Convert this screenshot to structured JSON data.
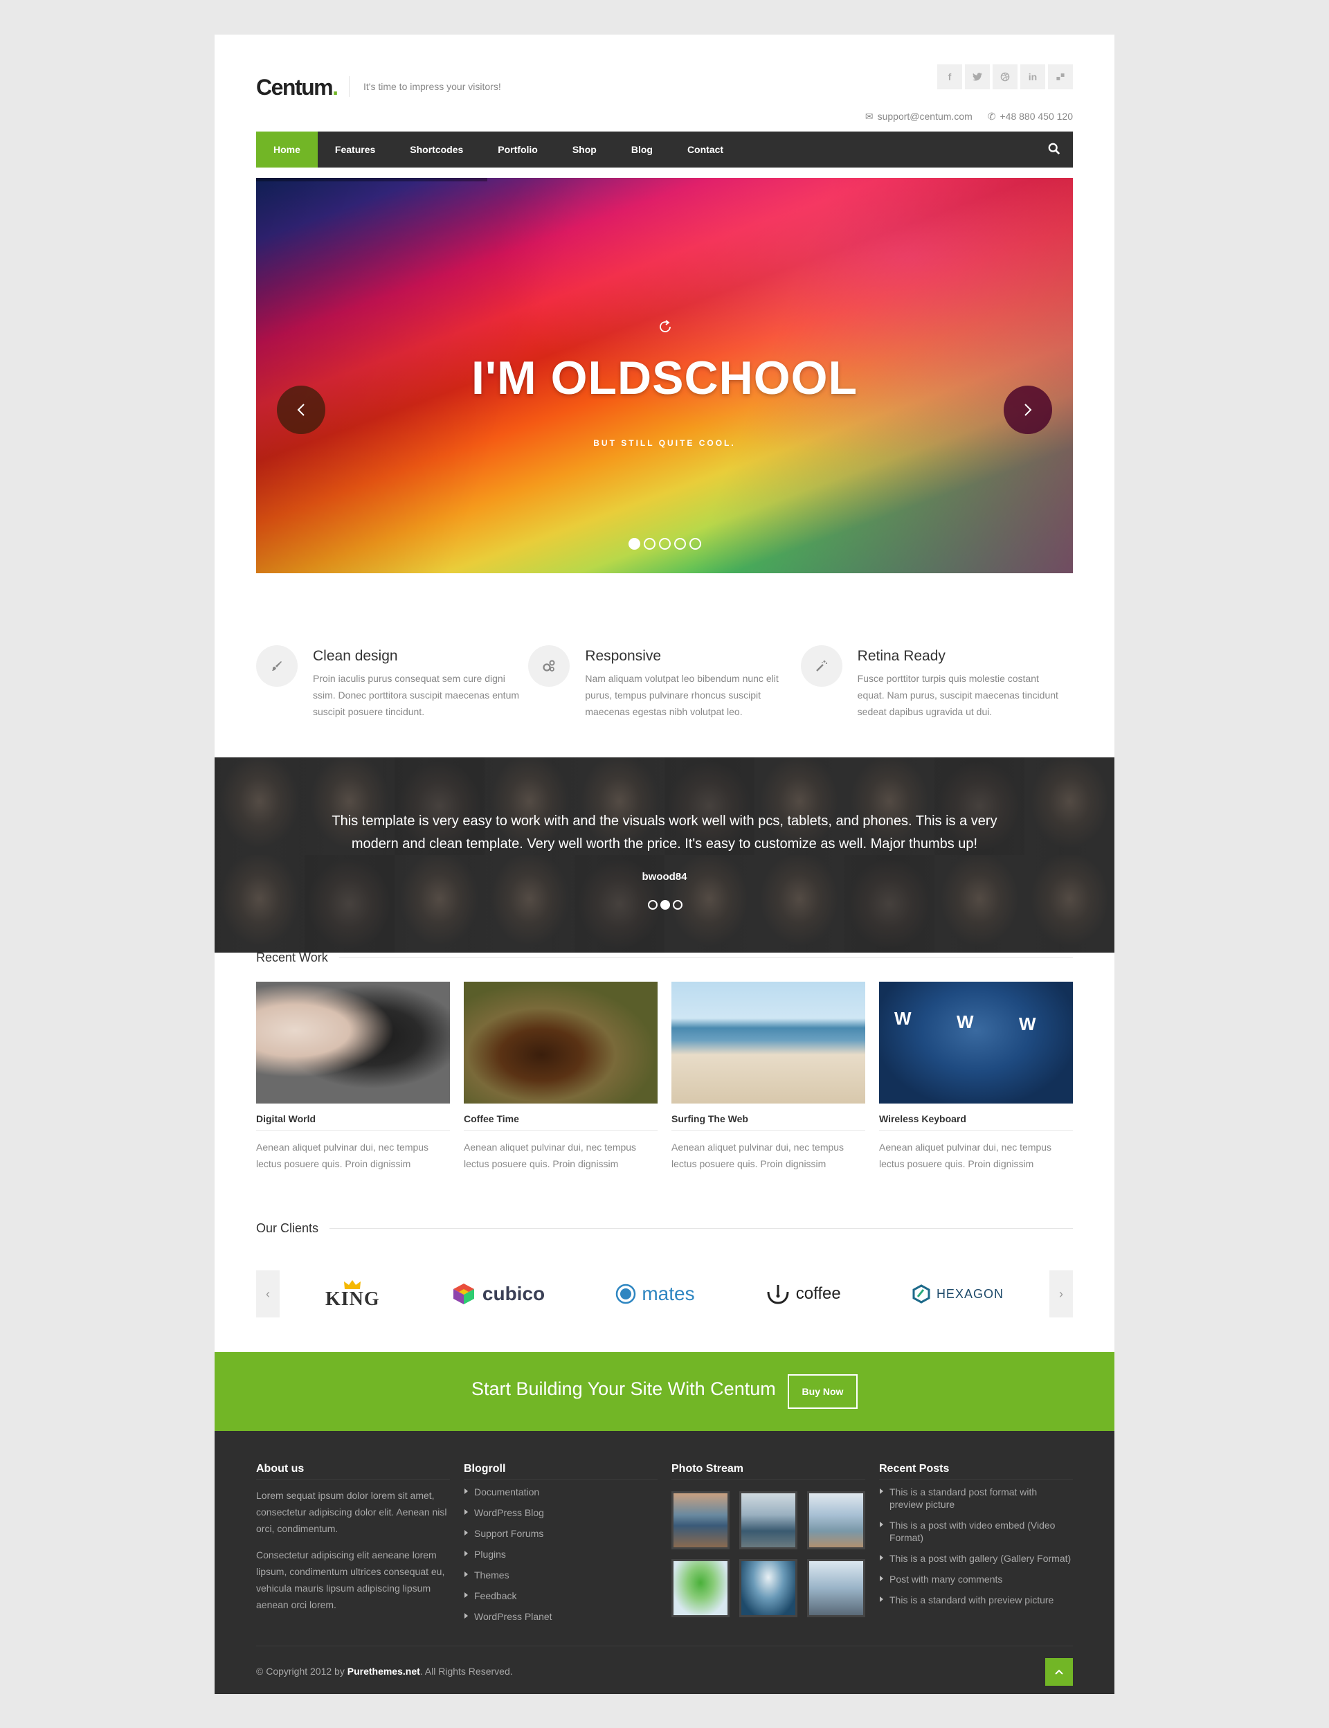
{
  "header": {
    "logo": "Centum",
    "logo_dot": ".",
    "tagline": "It's time to impress your visitors!",
    "social": [
      "f",
      "t",
      "dribbble",
      "in",
      "flickr"
    ],
    "email": "support@centum.com",
    "phone": "+48 880 450 120"
  },
  "nav": {
    "items": [
      "Home",
      "Features",
      "Shortcodes",
      "Portfolio",
      "Shop",
      "Blog",
      "Contact"
    ],
    "active": "Home"
  },
  "slider": {
    "title": "I'M OLDSCHOOL",
    "subtitle": "BUT STILL QUITE COOL.",
    "slide_count": 5,
    "current_slide": 1
  },
  "features": [
    {
      "title": "Clean design",
      "text": "Proin iaculis purus consequat sem cure digni ssim. Donec porttitora suscipit maecenas entum suscipit posuere tincidunt.",
      "icon": "brush-icon"
    },
    {
      "title": "Responsive",
      "text": "Nam aliquam volutpat leo bibendum nunc elit purus, tempus pulvinare rhoncus suscipit maecenas egestas nibh volutpat leo.",
      "icon": "gears-icon"
    },
    {
      "title": "Retina Ready",
      "text": "Fusce porttitor turpis quis molestie costant equat. Nam purus, suscipit maecenas tincidunt sedeat dapibus ugravida ut dui.",
      "icon": "magic-wand-icon"
    }
  ],
  "testimonial": {
    "quote": "This template is very easy to work with and the visuals work well with pcs, tablets, and phones. This is a very modern and clean template. Very well worth the price. It's easy to customize as well. Major thumbs up!",
    "author": "bwood84",
    "dots": 3,
    "current": 2
  },
  "recent_work": {
    "heading": "Recent Work",
    "items": [
      {
        "title": "Digital World",
        "text": "Aenean aliquet pulvinar dui, nec tempus lectus posuere quis. Proin dignissim"
      },
      {
        "title": "Coffee Time",
        "text": "Aenean aliquet pulvinar dui, nec tempus lectus posuere quis. Proin dignissim"
      },
      {
        "title": "Surfing The Web",
        "text": "Aenean aliquet pulvinar dui, nec tempus lectus posuere quis. Proin dignissim"
      },
      {
        "title": "Wireless Keyboard",
        "text": "Aenean aliquet pulvinar dui, nec tempus lectus posuere quis. Proin dignissim"
      }
    ]
  },
  "clients": {
    "heading": "Our Clients",
    "logos": [
      "KING",
      "cubico",
      "mates",
      "coffee",
      "HEXAGON"
    ]
  },
  "cta": {
    "text": "Start Building Your Site With Centum",
    "button": "Buy Now"
  },
  "footer": {
    "about": {
      "heading": "About us",
      "p1": "Lorem sequat ipsum dolor lorem sit amet, consectetur adipiscing dolor elit. Aenean nisl orci, condimentum.",
      "p2": "Consectetur adipiscing elit aeneane lorem lipsum, condimentum ultrices consequat eu, vehicula mauris lipsum adipiscing lipsum aenean orci lorem."
    },
    "blogroll": {
      "heading": "Blogroll",
      "links": [
        "Documentation",
        "WordPress Blog",
        "Support Forums",
        "Plugins",
        "Themes",
        "Feedback",
        "WordPress Planet"
      ]
    },
    "photo_stream": {
      "heading": "Photo Stream"
    },
    "recent_posts": {
      "heading": "Recent Posts",
      "posts": [
        "This is a standard post format with preview picture",
        "This is a post with video embed (Video Format)",
        "This is a post with gallery (Gallery Format)",
        "Post with many comments",
        "This is a standard with preview picture"
      ]
    },
    "copyright_prefix": "© Copyright 2012 by ",
    "copyright_brand": "Purethemes.net",
    "copyright_suffix": ". All Rights Reserved."
  },
  "colors": {
    "accent": "#72b626",
    "nav_bg": "#303030",
    "footer_bg": "#2f2f2f"
  }
}
